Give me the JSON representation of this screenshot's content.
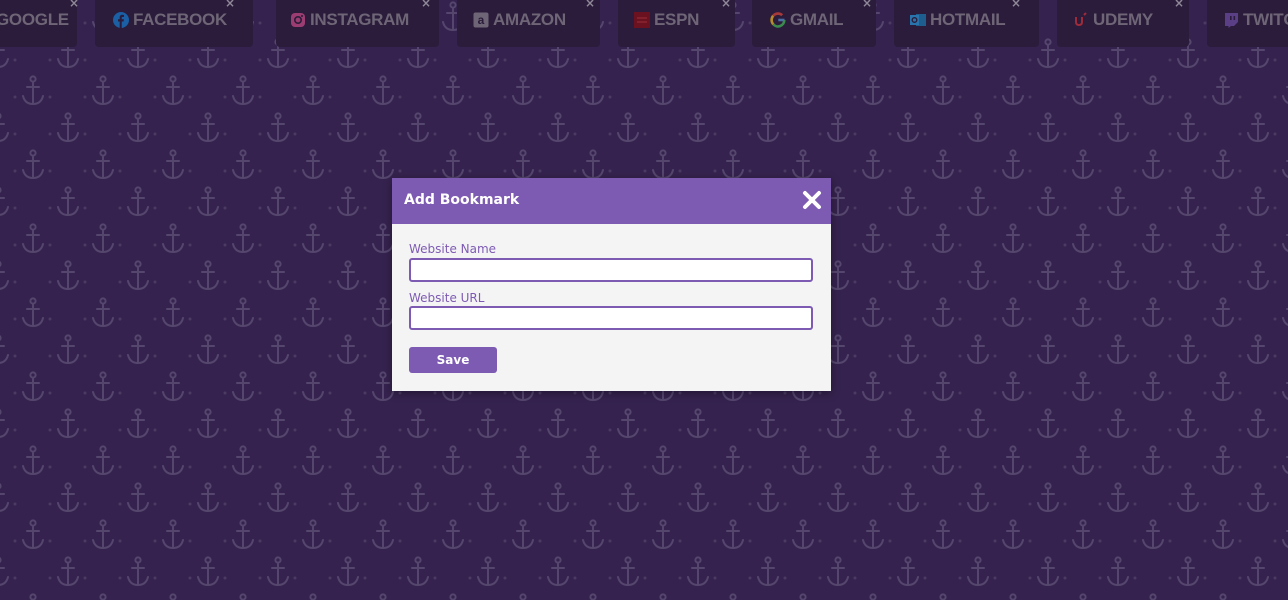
{
  "colors": {
    "background": "#35224e",
    "pattern": "#54466d",
    "tile_background": "#2a1c3a",
    "tile_text": "#6e6677",
    "accent": "#7e5bb3",
    "modal_body": "#f4f4f5"
  },
  "bookmarks": [
    {
      "label": "GOOGLE",
      "icon": "google-icon"
    },
    {
      "label": "FACEBOOK",
      "icon": "facebook-icon"
    },
    {
      "label": "INSTAGRAM",
      "icon": "instagram-icon"
    },
    {
      "label": "AMAZON",
      "icon": "amazon-icon"
    },
    {
      "label": "ESPN",
      "icon": "espn-icon"
    },
    {
      "label": "GMAIL",
      "icon": "gmail-icon"
    },
    {
      "label": "HOTMAIL",
      "icon": "hotmail-icon"
    },
    {
      "label": "UDEMY",
      "icon": "udemy-icon"
    },
    {
      "label": "TWITCH",
      "icon": "twitch-icon"
    }
  ],
  "bookmark_close_glyph": "×",
  "modal": {
    "title": "Add Bookmark",
    "close_icon": "close-icon",
    "name_label": "Website Name",
    "name_value": "",
    "url_label": "Website URL",
    "url_value": "",
    "save_label": "Save"
  }
}
